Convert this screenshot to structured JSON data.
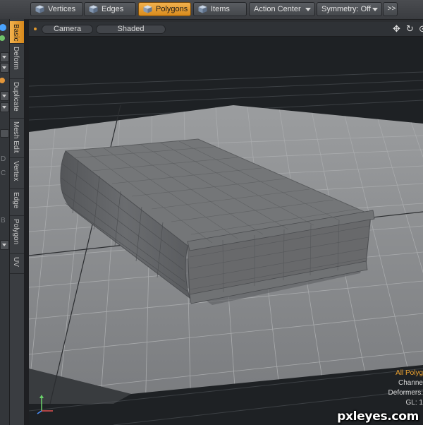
{
  "toolbar": {
    "modes": [
      {
        "label": "Vertices",
        "icon": "vertices-cube-icon",
        "active": false
      },
      {
        "label": "Edges",
        "icon": "edges-cube-icon",
        "active": false
      },
      {
        "label": "Polygons",
        "icon": "polygons-cube-icon",
        "active": true
      },
      {
        "label": "Items",
        "icon": "items-cube-icon",
        "active": false
      }
    ],
    "action_center": "Action Center",
    "symmetry": "Symmetry: Off",
    "more": ">>"
  },
  "side_tabs": [
    {
      "label": "Basic",
      "active": true
    },
    {
      "label": "Deform",
      "active": false
    },
    {
      "label": "Duplicate",
      "active": false
    },
    {
      "label": "Mesh Edit",
      "active": false
    },
    {
      "label": "Vertex",
      "active": false
    },
    {
      "label": "Edge",
      "active": false
    },
    {
      "label": "Polygon",
      "active": false
    },
    {
      "label": "UV",
      "active": false
    }
  ],
  "left_strip_glyphs": [
    "D",
    "C",
    "B"
  ],
  "viewport": {
    "camera": "Camera",
    "shading": "Shaded",
    "icons": [
      "move-view-icon",
      "rotate-view-icon",
      "zoom-view-icon"
    ]
  },
  "info_overlay": {
    "selection_mode": "All Polyg",
    "channels": "Channe",
    "deformers": "Deformers:",
    "gl": "GL: 1"
  },
  "watermark": "pxleyes.com",
  "colors": {
    "accent_orange": "#e89e2c",
    "panel": "#3a3d41",
    "viewport_bg": "#1d2023",
    "floor": "#888a8c",
    "mesh": "#6d6f71"
  }
}
